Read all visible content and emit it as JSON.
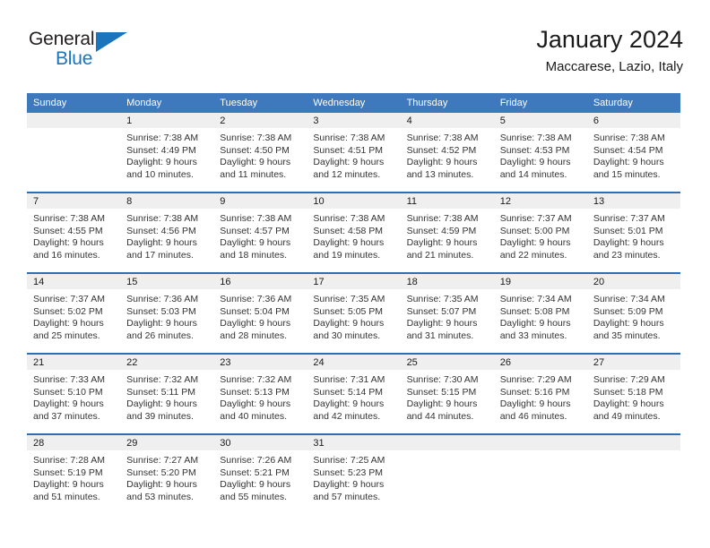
{
  "brand": {
    "name_top": "General",
    "name_bottom": "Blue",
    "color_primary": "#1b75bc",
    "color_text": "#231f20"
  },
  "header": {
    "title": "January 2024",
    "subtitle": "Maccarese, Lazio, Italy"
  },
  "theme": {
    "header_row_bg": "#3e79bd",
    "row_divider": "#2f6eb5",
    "daynum_band_bg": "#efefef"
  },
  "calendar": {
    "weekday_headers": [
      "Sunday",
      "Monday",
      "Tuesday",
      "Wednesday",
      "Thursday",
      "Friday",
      "Saturday"
    ],
    "weeks": [
      [
        {
          "day": "",
          "sunrise": "",
          "sunset": "",
          "daylight_1": "",
          "daylight_2": "",
          "empty": true
        },
        {
          "day": "1",
          "sunrise": "Sunrise: 7:38 AM",
          "sunset": "Sunset: 4:49 PM",
          "daylight_1": "Daylight: 9 hours",
          "daylight_2": "and 10 minutes."
        },
        {
          "day": "2",
          "sunrise": "Sunrise: 7:38 AM",
          "sunset": "Sunset: 4:50 PM",
          "daylight_1": "Daylight: 9 hours",
          "daylight_2": "and 11 minutes."
        },
        {
          "day": "3",
          "sunrise": "Sunrise: 7:38 AM",
          "sunset": "Sunset: 4:51 PM",
          "daylight_1": "Daylight: 9 hours",
          "daylight_2": "and 12 minutes."
        },
        {
          "day": "4",
          "sunrise": "Sunrise: 7:38 AM",
          "sunset": "Sunset: 4:52 PM",
          "daylight_1": "Daylight: 9 hours",
          "daylight_2": "and 13 minutes."
        },
        {
          "day": "5",
          "sunrise": "Sunrise: 7:38 AM",
          "sunset": "Sunset: 4:53 PM",
          "daylight_1": "Daylight: 9 hours",
          "daylight_2": "and 14 minutes."
        },
        {
          "day": "6",
          "sunrise": "Sunrise: 7:38 AM",
          "sunset": "Sunset: 4:54 PM",
          "daylight_1": "Daylight: 9 hours",
          "daylight_2": "and 15 minutes."
        }
      ],
      [
        {
          "day": "7",
          "sunrise": "Sunrise: 7:38 AM",
          "sunset": "Sunset: 4:55 PM",
          "daylight_1": "Daylight: 9 hours",
          "daylight_2": "and 16 minutes."
        },
        {
          "day": "8",
          "sunrise": "Sunrise: 7:38 AM",
          "sunset": "Sunset: 4:56 PM",
          "daylight_1": "Daylight: 9 hours",
          "daylight_2": "and 17 minutes."
        },
        {
          "day": "9",
          "sunrise": "Sunrise: 7:38 AM",
          "sunset": "Sunset: 4:57 PM",
          "daylight_1": "Daylight: 9 hours",
          "daylight_2": "and 18 minutes."
        },
        {
          "day": "10",
          "sunrise": "Sunrise: 7:38 AM",
          "sunset": "Sunset: 4:58 PM",
          "daylight_1": "Daylight: 9 hours",
          "daylight_2": "and 19 minutes."
        },
        {
          "day": "11",
          "sunrise": "Sunrise: 7:38 AM",
          "sunset": "Sunset: 4:59 PM",
          "daylight_1": "Daylight: 9 hours",
          "daylight_2": "and 21 minutes."
        },
        {
          "day": "12",
          "sunrise": "Sunrise: 7:37 AM",
          "sunset": "Sunset: 5:00 PM",
          "daylight_1": "Daylight: 9 hours",
          "daylight_2": "and 22 minutes."
        },
        {
          "day": "13",
          "sunrise": "Sunrise: 7:37 AM",
          "sunset": "Sunset: 5:01 PM",
          "daylight_1": "Daylight: 9 hours",
          "daylight_2": "and 23 minutes."
        }
      ],
      [
        {
          "day": "14",
          "sunrise": "Sunrise: 7:37 AM",
          "sunset": "Sunset: 5:02 PM",
          "daylight_1": "Daylight: 9 hours",
          "daylight_2": "and 25 minutes."
        },
        {
          "day": "15",
          "sunrise": "Sunrise: 7:36 AM",
          "sunset": "Sunset: 5:03 PM",
          "daylight_1": "Daylight: 9 hours",
          "daylight_2": "and 26 minutes."
        },
        {
          "day": "16",
          "sunrise": "Sunrise: 7:36 AM",
          "sunset": "Sunset: 5:04 PM",
          "daylight_1": "Daylight: 9 hours",
          "daylight_2": "and 28 minutes."
        },
        {
          "day": "17",
          "sunrise": "Sunrise: 7:35 AM",
          "sunset": "Sunset: 5:05 PM",
          "daylight_1": "Daylight: 9 hours",
          "daylight_2": "and 30 minutes."
        },
        {
          "day": "18",
          "sunrise": "Sunrise: 7:35 AM",
          "sunset": "Sunset: 5:07 PM",
          "daylight_1": "Daylight: 9 hours",
          "daylight_2": "and 31 minutes."
        },
        {
          "day": "19",
          "sunrise": "Sunrise: 7:34 AM",
          "sunset": "Sunset: 5:08 PM",
          "daylight_1": "Daylight: 9 hours",
          "daylight_2": "and 33 minutes."
        },
        {
          "day": "20",
          "sunrise": "Sunrise: 7:34 AM",
          "sunset": "Sunset: 5:09 PM",
          "daylight_1": "Daylight: 9 hours",
          "daylight_2": "and 35 minutes."
        }
      ],
      [
        {
          "day": "21",
          "sunrise": "Sunrise: 7:33 AM",
          "sunset": "Sunset: 5:10 PM",
          "daylight_1": "Daylight: 9 hours",
          "daylight_2": "and 37 minutes."
        },
        {
          "day": "22",
          "sunrise": "Sunrise: 7:32 AM",
          "sunset": "Sunset: 5:11 PM",
          "daylight_1": "Daylight: 9 hours",
          "daylight_2": "and 39 minutes."
        },
        {
          "day": "23",
          "sunrise": "Sunrise: 7:32 AM",
          "sunset": "Sunset: 5:13 PM",
          "daylight_1": "Daylight: 9 hours",
          "daylight_2": "and 40 minutes."
        },
        {
          "day": "24",
          "sunrise": "Sunrise: 7:31 AM",
          "sunset": "Sunset: 5:14 PM",
          "daylight_1": "Daylight: 9 hours",
          "daylight_2": "and 42 minutes."
        },
        {
          "day": "25",
          "sunrise": "Sunrise: 7:30 AM",
          "sunset": "Sunset: 5:15 PM",
          "daylight_1": "Daylight: 9 hours",
          "daylight_2": "and 44 minutes."
        },
        {
          "day": "26",
          "sunrise": "Sunrise: 7:29 AM",
          "sunset": "Sunset: 5:16 PM",
          "daylight_1": "Daylight: 9 hours",
          "daylight_2": "and 46 minutes."
        },
        {
          "day": "27",
          "sunrise": "Sunrise: 7:29 AM",
          "sunset": "Sunset: 5:18 PM",
          "daylight_1": "Daylight: 9 hours",
          "daylight_2": "and 49 minutes."
        }
      ],
      [
        {
          "day": "28",
          "sunrise": "Sunrise: 7:28 AM",
          "sunset": "Sunset: 5:19 PM",
          "daylight_1": "Daylight: 9 hours",
          "daylight_2": "and 51 minutes."
        },
        {
          "day": "29",
          "sunrise": "Sunrise: 7:27 AM",
          "sunset": "Sunset: 5:20 PM",
          "daylight_1": "Daylight: 9 hours",
          "daylight_2": "and 53 minutes."
        },
        {
          "day": "30",
          "sunrise": "Sunrise: 7:26 AM",
          "sunset": "Sunset: 5:21 PM",
          "daylight_1": "Daylight: 9 hours",
          "daylight_2": "and 55 minutes."
        },
        {
          "day": "31",
          "sunrise": "Sunrise: 7:25 AM",
          "sunset": "Sunset: 5:23 PM",
          "daylight_1": "Daylight: 9 hours",
          "daylight_2": "and 57 minutes."
        },
        {
          "day": "",
          "sunrise": "",
          "sunset": "",
          "daylight_1": "",
          "daylight_2": "",
          "empty": true
        },
        {
          "day": "",
          "sunrise": "",
          "sunset": "",
          "daylight_1": "",
          "daylight_2": "",
          "empty": true
        },
        {
          "day": "",
          "sunrise": "",
          "sunset": "",
          "daylight_1": "",
          "daylight_2": "",
          "empty": true
        }
      ]
    ]
  }
}
